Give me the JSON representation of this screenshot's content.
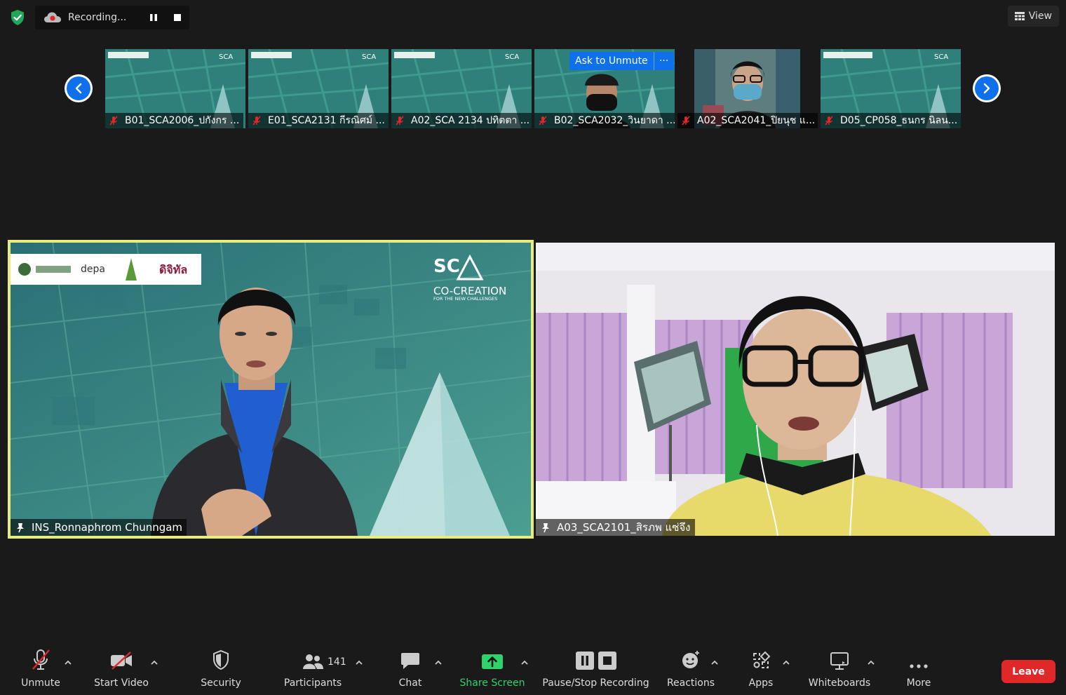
{
  "recording": {
    "status_text": "Recording..."
  },
  "view": {
    "label": "View"
  },
  "thumbnails": [
    {
      "name": "B01_SCA2006_ปกังกร ..."
    },
    {
      "name": "E01_SCA2131 กีรณิศม์ ..."
    },
    {
      "name": "A02_SCA 2134 ปทิตตา ..."
    },
    {
      "name": "B02_SCA2032_วินยาดา ..."
    },
    {
      "name": "A02_SCA2041_ปิยนุช แ..."
    },
    {
      "name": "D05_CP058_ธนกร นิลน..."
    }
  ],
  "ask_to_unmute": {
    "label": "Ask to Unmute",
    "more": "···"
  },
  "main_videos": [
    {
      "name": "INS_Ronnaphrom Chunngam"
    },
    {
      "name": "A03_SCA2101_สิรภพ แซ่จึง"
    }
  ],
  "background": {
    "logo_sc": "SC",
    "logo_cocreation": "CO-CREATION",
    "logo_tagline": "FOR THE NEW CHALLENGES",
    "partner_depa": "depa",
    "partner_dtt": "ดิจิทัล"
  },
  "toolbar": {
    "unmute": "Unmute",
    "start_video": "Start Video",
    "security": "Security",
    "participants": "Participants",
    "participants_count": "141",
    "chat": "Chat",
    "share_screen": "Share Screen",
    "pause_stop_recording": "Pause/Stop Recording",
    "reactions": "Reactions",
    "apps": "Apps",
    "whiteboards": "Whiteboards",
    "more": "More",
    "leave": "Leave"
  },
  "colors": {
    "background": "#1a1a1a",
    "accent_blue": "#0e71eb",
    "share_green": "#2ed46b",
    "leave_red": "#e02828",
    "active_speaker": "#e8eb80",
    "muted_red": "#e02828"
  }
}
